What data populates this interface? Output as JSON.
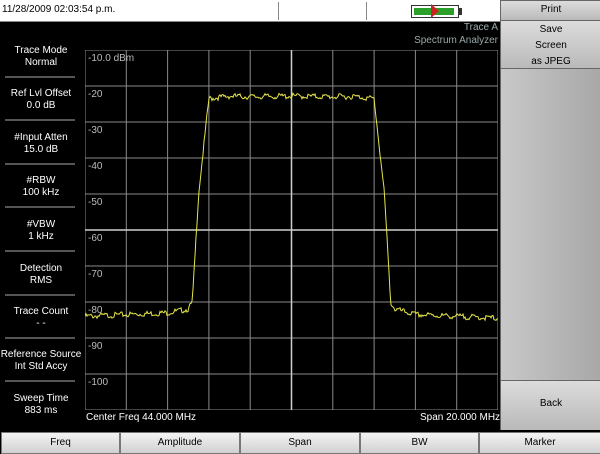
{
  "status": {
    "datetime": "11/28/2009 02:03:54 p.m."
  },
  "header": {
    "trace": "Trace A",
    "mode": "Spectrum Analyzer"
  },
  "params": [
    {
      "label": "Trace Mode",
      "value": "Normal"
    },
    {
      "label": "Ref Lvl Offset",
      "value": "0.0 dB"
    },
    {
      "label": "#Input Atten",
      "value": "15.0 dB"
    },
    {
      "label": "#RBW",
      "value": "100 kHz"
    },
    {
      "label": "#VBW",
      "value": "1 kHz"
    },
    {
      "label": "Detection",
      "value": "RMS"
    },
    {
      "label": "Trace Count",
      "value": "- -"
    },
    {
      "label": "Reference Source",
      "value": "Int Std Accy"
    },
    {
      "label": "Sweep Time",
      "value": "883 ms"
    }
  ],
  "plot": {
    "y_labels": [
      "-10.0 dBm",
      "-20",
      "-30",
      "-40",
      "-50",
      "-60",
      "-70",
      "-80",
      "-90",
      "-100"
    ],
    "center_freq": "Center Freq 44.000 MHz",
    "span": "Span 20.000 MHz"
  },
  "softkeys": {
    "print": "Print",
    "save_lines": [
      "Save",
      "Screen",
      "as JPEG"
    ],
    "back": "Back"
  },
  "menu": [
    "Freq",
    "Amplitude",
    "Span",
    "BW",
    "Marker"
  ],
  "colors": {
    "trace": "#e6e64a",
    "grid": "#8a8a8a",
    "background": "#000000",
    "battery": "#2aa02a",
    "arrow": "#cc2222"
  },
  "chart_data": {
    "type": "line",
    "xlabel": "Center Freq 44.000 MHz",
    "span_label": "Span 20.000 MHz",
    "x_range_mhz": [
      34,
      54
    ],
    "ylim": [
      -110,
      -10
    ],
    "y_ticks": [
      -10,
      -20,
      -30,
      -40,
      -50,
      -60,
      -70,
      -80,
      -90,
      -100
    ],
    "grid": true,
    "series": [
      {
        "x": [
          34,
          36,
          38,
          39.0,
          39.2,
          39.5,
          40,
          41,
          42,
          44,
          46,
          47,
          48,
          48.5,
          48.8,
          49.0,
          50,
          52,
          54
        ],
        "values": [
          -84,
          -83.5,
          -83,
          -82,
          -80,
          -50,
          -23.5,
          -22.8,
          -23,
          -22.8,
          -23,
          -22.9,
          -23.5,
          -50,
          -80,
          -82,
          -83.5,
          -84,
          -84.5
        ]
      }
    ]
  }
}
